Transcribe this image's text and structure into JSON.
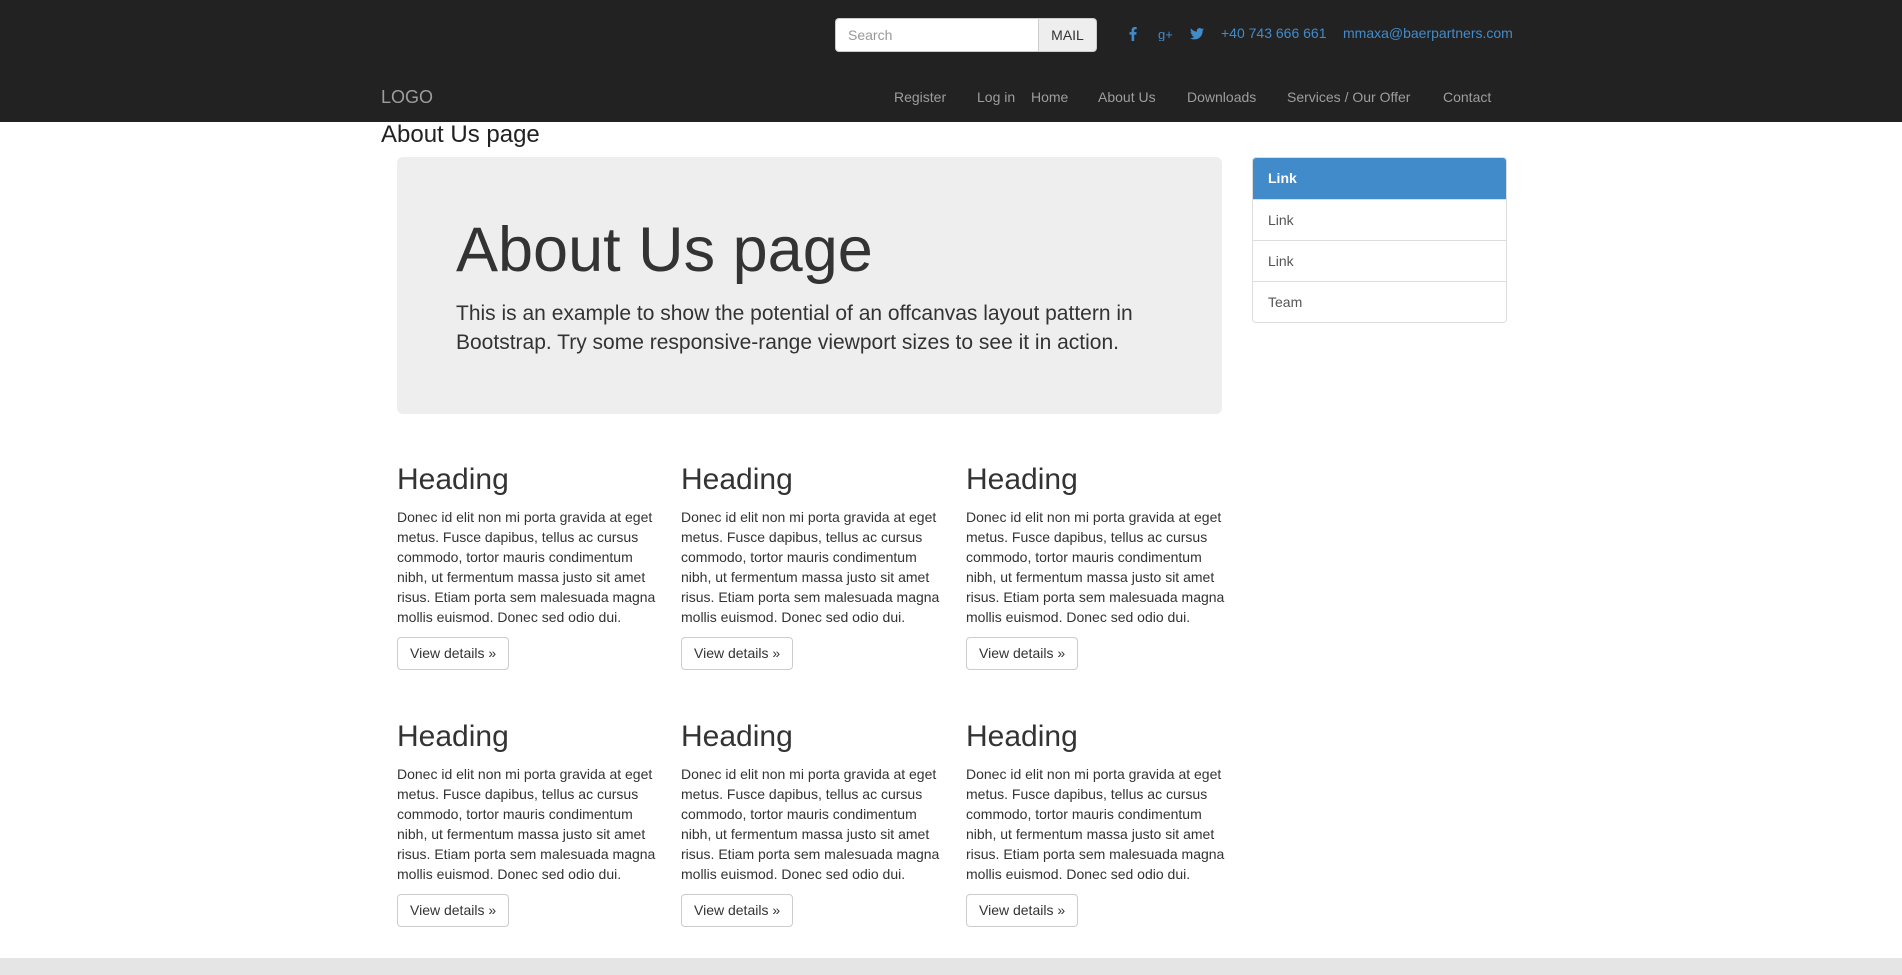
{
  "topbar": {
    "search_placeholder": "Search",
    "mail_label": "MAIL",
    "social": [
      "facebook-icon",
      "google-plus-icon",
      "twitter-icon"
    ],
    "phone": "+40 743 666 661",
    "email": "mmaxa@baerpartners.com"
  },
  "navbar": {
    "logo": "LOGO",
    "items": [
      "Register",
      "Log in",
      "Home",
      "About Us",
      "Downloads",
      "Services / Our Offer",
      "Contact"
    ]
  },
  "page": {
    "title": "About Us page"
  },
  "jumbotron": {
    "title": "About Us page",
    "text": "This is an example to show the potential of an offcanvas layout pattern in Bootstrap. Try some responsive-range viewport sizes to see it in action."
  },
  "cards": [
    {
      "heading": "Heading",
      "text": "Donec id elit non mi porta gravida at eget metus. Fusce dapibus, tellus ac cursus commodo, tortor mauris condimentum nibh, ut fermentum massa justo sit amet risus. Etiam porta sem malesuada magna mollis euismod. Donec sed odio dui.",
      "button": "View details »"
    },
    {
      "heading": "Heading",
      "text": "Donec id elit non mi porta gravida at eget metus. Fusce dapibus, tellus ac cursus commodo, tortor mauris condimentum nibh, ut fermentum massa justo sit amet risus. Etiam porta sem malesuada magna mollis euismod. Donec sed odio dui.",
      "button": "View details »"
    },
    {
      "heading": "Heading",
      "text": "Donec id elit non mi porta gravida at eget metus. Fusce dapibus, tellus ac cursus commodo, tortor mauris condimentum nibh, ut fermentum massa justo sit amet risus. Etiam porta sem malesuada magna mollis euismod. Donec sed odio dui.",
      "button": "View details »"
    },
    {
      "heading": "Heading",
      "text": "Donec id elit non mi porta gravida at eget metus. Fusce dapibus, tellus ac cursus commodo, tortor mauris condimentum nibh, ut fermentum massa justo sit amet risus. Etiam porta sem malesuada magna mollis euismod. Donec sed odio dui.",
      "button": "View details »"
    },
    {
      "heading": "Heading",
      "text": "Donec id elit non mi porta gravida at eget metus. Fusce dapibus, tellus ac cursus commodo, tortor mauris condimentum nibh, ut fermentum massa justo sit amet risus. Etiam porta sem malesuada magna mollis euismod. Donec sed odio dui.",
      "button": "View details »"
    },
    {
      "heading": "Heading",
      "text": "Donec id elit non mi porta gravida at eget metus. Fusce dapibus, tellus ac cursus commodo, tortor mauris condimentum nibh, ut fermentum massa justo sit amet risus. Etiam porta sem malesuada magna mollis euismod. Donec sed odio dui.",
      "button": "View details »"
    }
  ],
  "sidebar": {
    "active_index": 0,
    "items": [
      "Link",
      "Link",
      "Link",
      "Team"
    ]
  },
  "colors": {
    "topbar_bg": "#222222",
    "accent": "#428bca",
    "nav_text": "#9d9d9d",
    "jumbotron_bg": "#eeeeee"
  }
}
